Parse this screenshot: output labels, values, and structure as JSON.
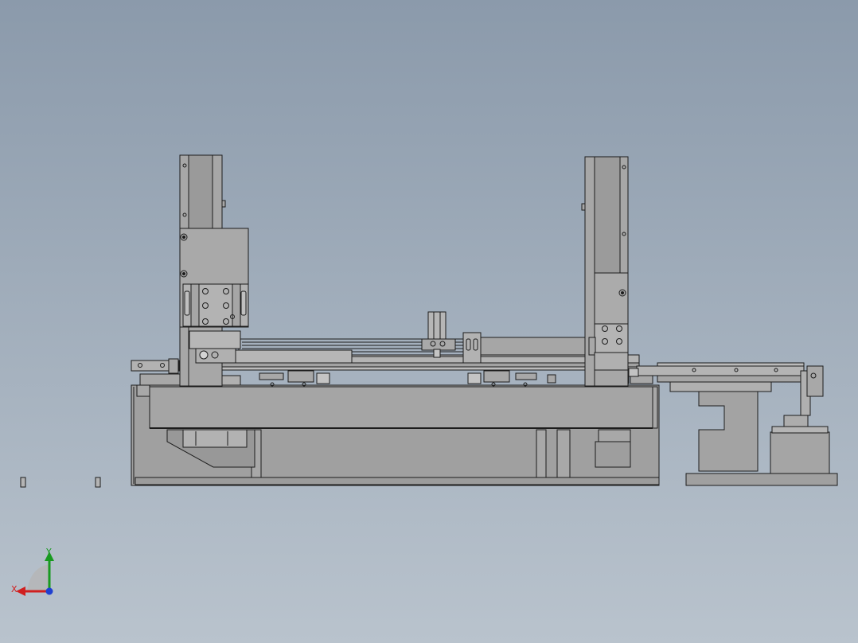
{
  "viewport": {
    "background_top": "#8b9aab",
    "background_bottom": "#b9c3cd",
    "part_fill": "#a8a8a8",
    "part_dark_fill": "#9a9a9a",
    "edge_color": "#1c1c1c"
  },
  "triad": {
    "x_label": "X",
    "y_label": "Y",
    "x_color": "#d02020",
    "y_color": "#189a20",
    "z_color": "#2040d0"
  }
}
